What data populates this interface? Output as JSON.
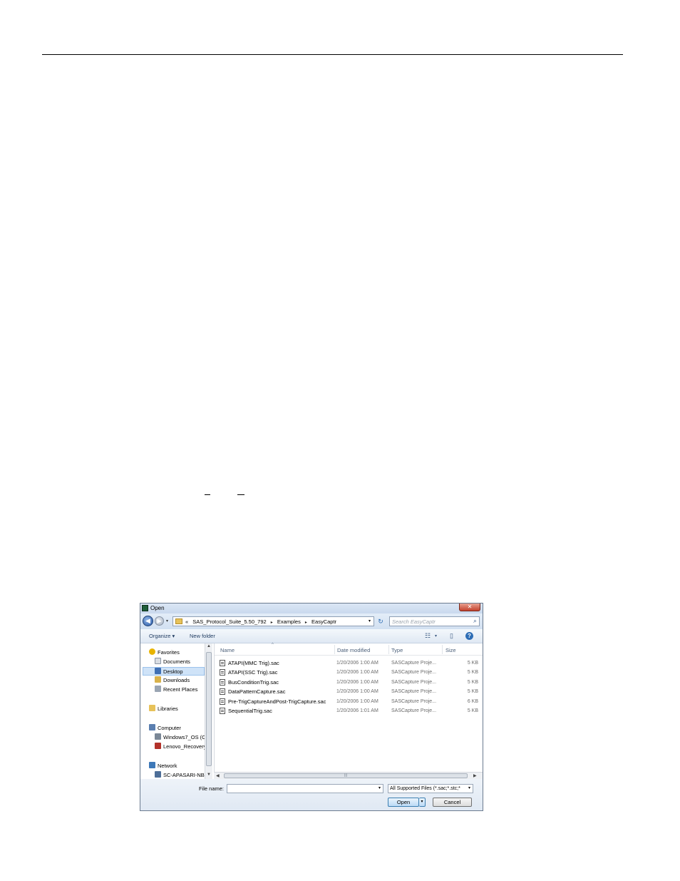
{
  "dialog": {
    "title": "Open",
    "close_glyph": "✕",
    "nav": {
      "back_glyph": "◀",
      "forward_glyph": "▶",
      "breadcrumb": [
        "«",
        "SAS_Protocol_Suite_5.50_792",
        "Examples",
        "EasyCaptr"
      ],
      "breadcrumb_sep": "▸",
      "refresh_glyph": "↻",
      "search_placeholder": "Search EasyCaptr"
    },
    "toolbar": {
      "organize": "Organize ▾",
      "new_folder": "New folder"
    },
    "sidebar": {
      "items": [
        {
          "label": "Favorites",
          "color": "#e8b400"
        },
        {
          "label": "Documents",
          "color": "#d9dde3"
        },
        {
          "label": "Desktop",
          "color": "#3f6fb4"
        },
        {
          "label": "Downloads",
          "color": "#d9b24a"
        },
        {
          "label": "Recent Places",
          "color": "#9aa5b3"
        },
        {
          "label": "Libraries",
          "color": "#e7c25a"
        },
        {
          "label": "Computer",
          "color": "#5b7fb0"
        },
        {
          "label": "Windows7_OS (C",
          "color": "#7a8796"
        },
        {
          "label": "Lenovo_Recovery",
          "color": "#b3322a"
        },
        {
          "label": "Network",
          "color": "#3d78b8"
        },
        {
          "label": "SC-APASARI-NB",
          "color": "#4d6e98"
        }
      ]
    },
    "columns": {
      "name": "Name",
      "date": "Date modified",
      "type": "Type",
      "size": "Size"
    },
    "files": [
      {
        "name": "ATAPI(MMC Trig).sac",
        "date": "1/20/2006 1:00 AM",
        "type": "SASCapture Proje...",
        "size": "5 KB"
      },
      {
        "name": "ATAPI(SSC Trig).sac",
        "date": "1/20/2006 1:00 AM",
        "type": "SASCapture Proje...",
        "size": "5 KB"
      },
      {
        "name": "BusConditionTrig.sac",
        "date": "1/20/2006 1:00 AM",
        "type": "SASCapture Proje...",
        "size": "5 KB"
      },
      {
        "name": "DataPatternCapture.sac",
        "date": "1/20/2006 1:00 AM",
        "type": "SASCapture Proje...",
        "size": "5 KB"
      },
      {
        "name": "Pre-TrigCaptureAndPost-TrigCapture.sac",
        "date": "1/20/2006 1:00 AM",
        "type": "SASCapture Proje...",
        "size": "6 KB"
      },
      {
        "name": "SequentialTrig.sac",
        "date": "1/20/2006 1:01 AM",
        "type": "SASCapture Proje...",
        "size": "5 KB"
      }
    ],
    "footer": {
      "file_name_label": "File name:",
      "file_name_value": "",
      "filter": "All Supported Files (*.sac;*.stc;*",
      "open": "Open",
      "split_glyph": "▾",
      "cancel": "Cancel"
    }
  }
}
